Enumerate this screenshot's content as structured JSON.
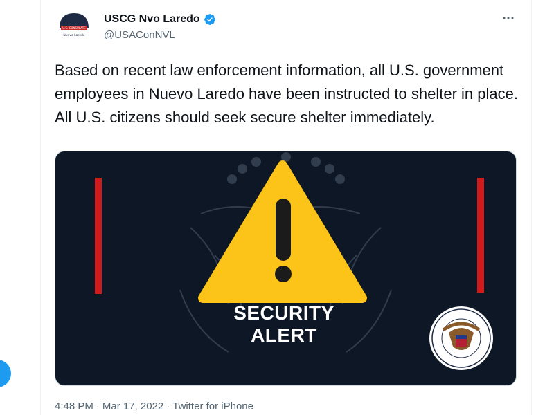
{
  "account": {
    "display_name": "USCG Nvo Laredo",
    "handle": "@USAConNVL",
    "verified": true,
    "avatar_icon": "consulate-logo",
    "avatar_text_top": "U.S. CONSULATE",
    "avatar_text_bottom": "Nuevo Laredo"
  },
  "tweet": {
    "text": "Based on recent law enforcement information, all U.S. government employees in Nuevo Laredo have been instructed to shelter in place.  All U.S. citizens should seek secure shelter immediately.",
    "timestamp_time": "4:48 PM",
    "separator": "·",
    "timestamp_date": "Mar 17, 2022",
    "source": "Twitter for iPhone"
  },
  "media": {
    "alert_line1": "SECURITY",
    "alert_line2": "ALERT",
    "seal_text_top": "UNITED STATES CONSULATE GENERAL",
    "seal_text_bottom": "NUEVO LAREDO",
    "warning_icon": "warning-triangle-icon",
    "colors": {
      "background": "#0e1726",
      "triangle": "#fcc419",
      "side_bars": "#d11a1a",
      "verified": "#1d9bf0"
    }
  },
  "icons": {
    "more": "more-horizontal-icon",
    "verified": "verified-badge-icon"
  }
}
